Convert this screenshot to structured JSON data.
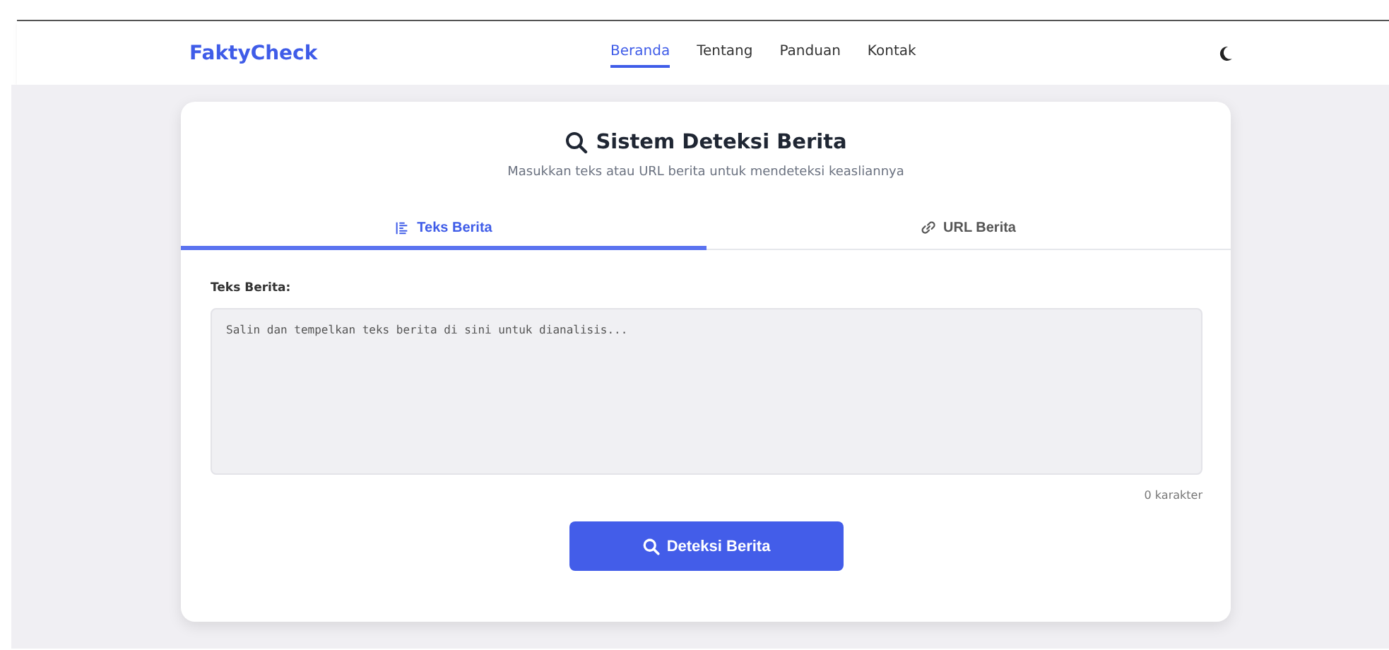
{
  "brand": "FaktyCheck",
  "nav": [
    {
      "label": "Beranda",
      "selected": true
    },
    {
      "label": "Tentang",
      "selected": false
    },
    {
      "label": "Panduan",
      "selected": false
    },
    {
      "label": "Kontak",
      "selected": false
    }
  ],
  "card": {
    "title": "Sistem Deteksi Berita",
    "subtitle": "Masukkan teks atau URL berita untuk mendeteksi keasliannya"
  },
  "tabs": [
    {
      "label": "Teks Berita",
      "kind": "lines",
      "selected": true
    },
    {
      "label": "URL Berita",
      "kind": "link",
      "selected": false
    }
  ],
  "form": {
    "label": "Teks Berita:",
    "placeholder": "Salin dan tempelkan teks berita di sini untuk dianalisis...",
    "counter": "0 karakter",
    "button": "Deteksi Berita"
  }
}
